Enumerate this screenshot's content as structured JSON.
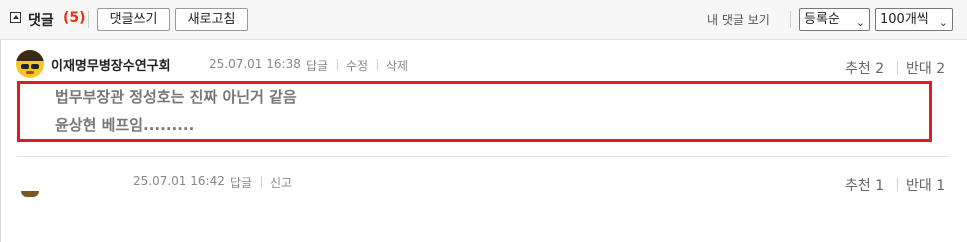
{
  "header": {
    "title": "댓글",
    "count": "(5)",
    "write_button": "댓글쓰기",
    "refresh_button": "새로고침",
    "my_comments_link": "내 댓글 보기",
    "sort_select": "등록순",
    "page_size_select": "100개씩"
  },
  "comments": [
    {
      "author": "이재명무병장수연구회",
      "date": "25.07.01 16:38",
      "actions": [
        "답글",
        "수정",
        "삭제"
      ],
      "recommend": "추천 2",
      "oppose": "반대 2",
      "lines": [
        "법무부장관 정성호는 진짜 아닌거 같음",
        "윤상현 베프임........."
      ]
    },
    {
      "date": "25.07.01 16:42",
      "actions": [
        "답글",
        "신고"
      ],
      "recommend": "추천 1",
      "oppose": "반대 1"
    }
  ],
  "colors": {
    "count": "#e2340f",
    "highlight_box": "#e01b24"
  },
  "icons": {
    "collapse": "collapse-icon",
    "select_arrow": "chevron-down-icon"
  }
}
